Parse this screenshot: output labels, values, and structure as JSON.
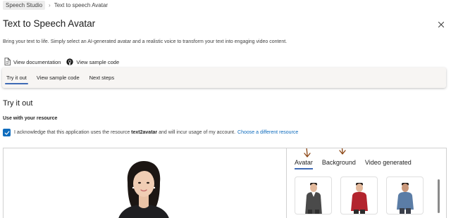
{
  "breadcrumb": {
    "root": "Speech Studio",
    "current": "Text to speech Avatar"
  },
  "header": {
    "title": "Text to Speech Avatar",
    "subtitle": "Bring your text to life. Simply select an AI-generated avatar and a realistic voice to transform your text into engaging video content."
  },
  "links": {
    "documentation": "View documentation",
    "sample_code": "View sample code"
  },
  "tabs": [
    {
      "label": "Try it out",
      "active": true
    },
    {
      "label": "View sample code",
      "active": false
    },
    {
      "label": "Next steps",
      "active": false
    }
  ],
  "try_it_out": {
    "title": "Try it out",
    "resource_label": "Use with your resource",
    "ack_prefix": "I acknowledge that this application uses the resource",
    "resource_name": "text2avatar",
    "ack_suffix": "and will incur usage of my account.",
    "change_resource_link": "Choose a different resource",
    "checkbox_checked": true
  },
  "side_panel": {
    "tabs": [
      {
        "label": "Avatar",
        "active": true
      },
      {
        "label": "Background",
        "active": false
      },
      {
        "label": "Video generated",
        "active": false
      }
    ],
    "thumbnails": [
      {
        "name": "avatar-dark-suit",
        "outfit_color": "#4a4a4a"
      },
      {
        "name": "avatar-red-sweater",
        "outfit_color": "#b3242e"
      },
      {
        "name": "avatar-denim-shirt",
        "outfit_color": "#5b7da6"
      }
    ]
  },
  "colors": {
    "accent": "#0f6cbd",
    "tab_underline": "#3f6bb5",
    "annotation": "#8b4513"
  }
}
